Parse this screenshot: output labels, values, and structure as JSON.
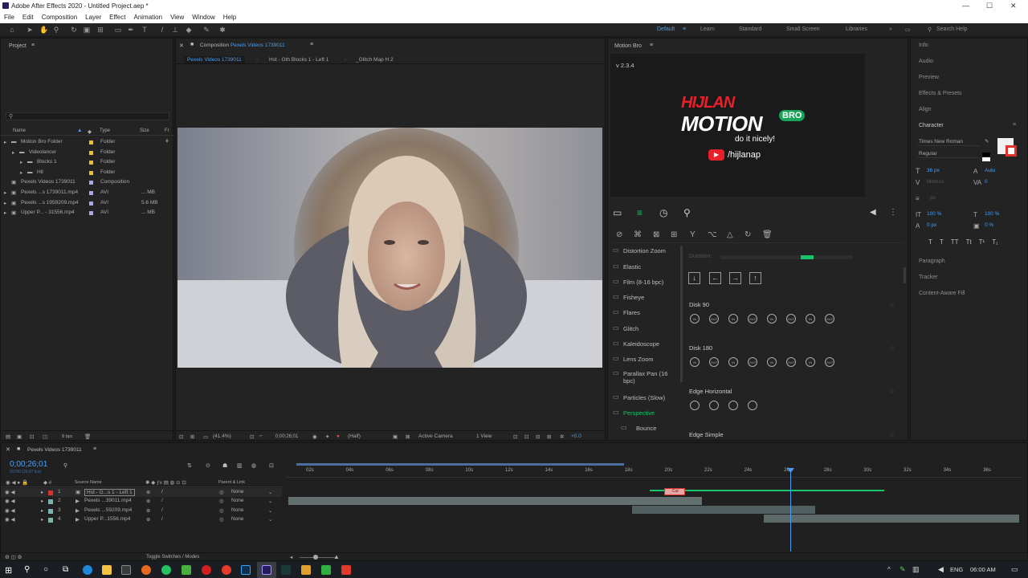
{
  "window": {
    "title": "Adobe After Effects 2020 - Untitled Project.aep *",
    "min": "—",
    "max": "☐",
    "close": "✕"
  },
  "menu": [
    "File",
    "Edit",
    "Composition",
    "Layer",
    "Effect",
    "Animation",
    "View",
    "Window",
    "Help"
  ],
  "workspaces": {
    "default": "Default",
    "learn": "Learn",
    "standard": "Standard",
    "small": "Small Screen",
    "libraries": "Libraries",
    "search": "Search Help"
  },
  "project": {
    "title": "Project",
    "cols": {
      "name": "Name",
      "type": "Type",
      "size": "Size",
      "fr": "Fr"
    },
    "items": [
      {
        "name": "Motion Bro Folder",
        "type": "Folder",
        "size": "",
        "color": "#e8c02a"
      },
      {
        "name": "Videolancer",
        "type": "Folder",
        "size": "",
        "color": "#e8c02a"
      },
      {
        "name": "Blocks 1",
        "type": "Folder",
        "size": "",
        "color": "#e8c02a"
      },
      {
        "name": "Hit",
        "type": "Folder",
        "size": "",
        "color": "#e8c02a"
      },
      {
        "name": "Pexels Videos 1739011",
        "type": "Composition",
        "size": "",
        "color": "#a9a9e8"
      },
      {
        "name": "Pexels ...s 1739011.mp4",
        "type": "AVI",
        "size": "... MB",
        "color": "#a9a9e8"
      },
      {
        "name": "Pexels ...s 1959209.mp4",
        "type": "AVI",
        "size": "5.6 MB",
        "color": "#a9a9e8"
      },
      {
        "name": "Upper P... - 31556.mp4",
        "type": "AVI",
        "size": "... MB",
        "color": "#a9a9e8"
      }
    ],
    "bpc": "8 bpc"
  },
  "comp": {
    "label": "Composition",
    "name": "Pexels Videos 1739011",
    "tabs": [
      "Pexels Videos 1739011",
      "Hst - Gth Blocks 1 - Left 1",
      "_Glitch Map H 2"
    ],
    "zoom": "(41.4%)",
    "time": "0;00;26;01",
    "res": "(Half)",
    "camera": "Active Camera",
    "view": "1 View",
    "exposure": "+0.0"
  },
  "motionbro": {
    "title": "Motion Bro",
    "version": "v 2.3.4",
    "brand_top": "HIJLAN",
    "brand": "MOTION",
    "badge": "BRO",
    "tagline": "do it nicely!",
    "channel": "/hijlanap",
    "categories": [
      "Distortion Zoom",
      "Elastic",
      "Film (8-16 bpc)",
      "Fisheye",
      "Flares",
      "Glitch",
      "Kaleidoscope",
      "Lens Zoom",
      "Parallax Pan (16 bpc)",
      "Particles (Slow)",
      "Perspective",
      "Bounce"
    ],
    "duration": "Duration:",
    "presets": [
      {
        "name": "Disk 90",
        "btns": [
          "IN",
          "OUT",
          "IN",
          "OUT",
          "IN",
          "OUT",
          "IN",
          "OUT"
        ]
      },
      {
        "name": "Disk 180",
        "btns": [
          "IN",
          "OUT",
          "IN",
          "OUT",
          "IN",
          "OUT",
          "IN",
          "OUT"
        ]
      },
      {
        "name": "Edge Horizontal",
        "btns": [
          "",
          "",
          "",
          ""
        ]
      },
      {
        "name": "Edge Simple",
        "btns": []
      }
    ]
  },
  "right": {
    "info": "Info",
    "audio": "Audio",
    "preview": "Preview",
    "effects": "Effects & Presets",
    "align": "Align",
    "character": "Character",
    "font": "Times New Roman",
    "style": "Regular",
    "size": "36 px",
    "leading": "Auto",
    "kern": "Metrics",
    "track": "0",
    "stroke": "- px",
    "vscale": "100 %",
    "hscale": "100 %",
    "baseline": "0 px",
    "tsume": "0 %",
    "styles": [
      "T",
      "T",
      "TT",
      "Tt",
      "T¹",
      "T₁"
    ],
    "paragraph": "Paragraph",
    "tracker": "Tracker",
    "caf": "Content-Aware Fill"
  },
  "timeline": {
    "comp": "Pexels Videos 1739011",
    "time": "0;00;26;01",
    "fps": "00780 (29.97 fps)",
    "cols": {
      "source": "Source Name",
      "parent": "Parent & Link"
    },
    "ticks": [
      "02s",
      "04s",
      "06s",
      "08s",
      "10s",
      "12s",
      "14s",
      "16s",
      "18s",
      "20s",
      "22s",
      "24s",
      "26s",
      "28s",
      "30s",
      "32s",
      "34s",
      "36s"
    ],
    "layers": [
      {
        "n": "1",
        "name": "Hst - G...s 1 - Left 1",
        "parent": "None",
        "color": "#d93030"
      },
      {
        "n": "2",
        "name": "Pexels ...39011.mp4",
        "parent": "None",
        "color": "#7fb0b0"
      },
      {
        "n": "3",
        "name": "Pexels ...59209.mp4",
        "parent": "None",
        "color": "#7fb0b0"
      },
      {
        "n": "4",
        "name": "Upper P...1556.mp4",
        "parent": "None",
        "color": "#7fb0b0"
      }
    ],
    "toggle": "Toggle Switches / Modes",
    "cut_label": "Cut"
  },
  "taskbar": {
    "lang": "ENG",
    "time": "06:00 AM"
  }
}
